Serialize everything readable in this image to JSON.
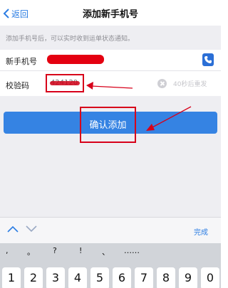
{
  "navbar": {
    "back_label": "返回",
    "title": "添加新手机号"
  },
  "hint": "添加手机号后，可以实时收到运单状态通知。",
  "form": {
    "phone_label": "新手机号",
    "code_label": "校验码",
    "code_value": "424120",
    "countdown": "40秒后重发"
  },
  "confirm_label": "确认添加",
  "keyboard": {
    "done_label": "完成",
    "symbols": [
      ",",
      "。",
      "?",
      "!",
      "、",
      "……"
    ],
    "keys": [
      "1",
      "2",
      "3",
      "4",
      "5",
      "6",
      "7",
      "8",
      "9",
      "0"
    ]
  },
  "colors": {
    "accent": "#2b7de3",
    "button": "#3583e3",
    "annotation": "#d7001a"
  }
}
